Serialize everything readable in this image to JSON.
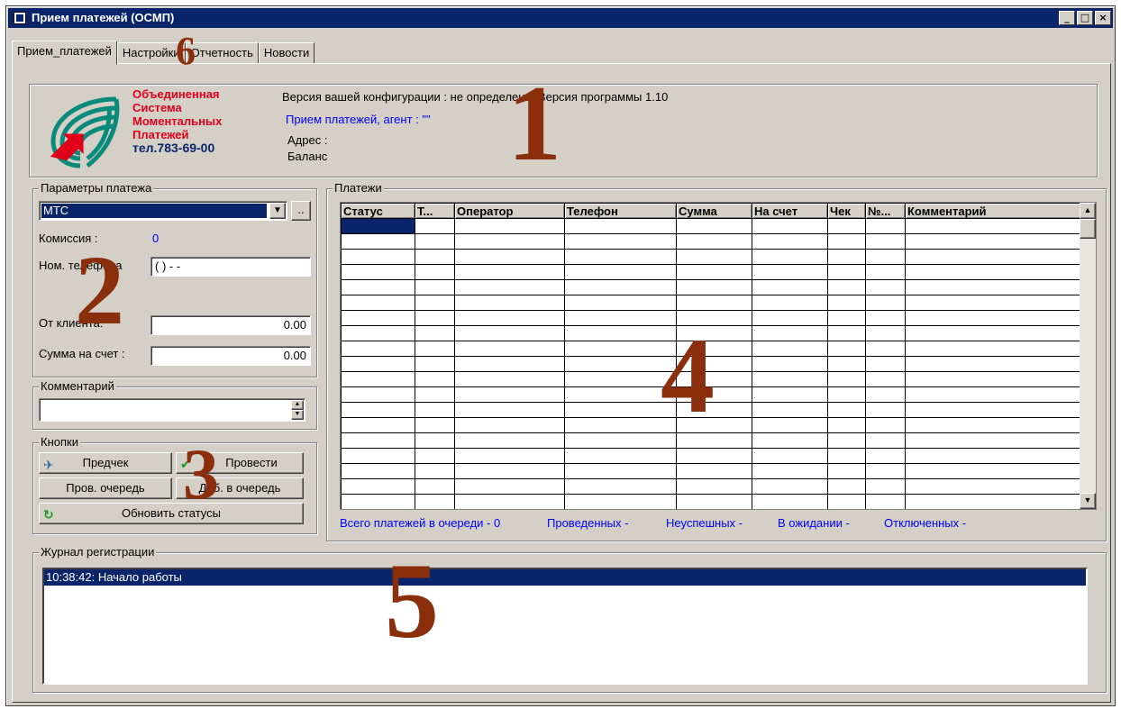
{
  "window": {
    "title": "Прием платежей (ОСМП)",
    "buttons": {
      "minimize": "_",
      "maximize": "□",
      "close": "×"
    }
  },
  "tabs": [
    {
      "label": "Прием_платежей",
      "active": true
    },
    {
      "label": "Настройки"
    },
    {
      "label": "Отчетность"
    },
    {
      "label": "Новости"
    }
  ],
  "logo": {
    "line1": "Объединенная",
    "line2": "Система",
    "line3": "Моментальных",
    "line4": "Платежей",
    "phone": "тел.783-69-00"
  },
  "info": {
    "version": "Версия вашей конфигурации :  не определена. Версия программы 1.10",
    "agent": "Прием платежей, агент : \"\"",
    "address": "Адрес :",
    "balance": "Баланс"
  },
  "params": {
    "legend": "Параметры платежа",
    "operator": "МТС",
    "browse": "..",
    "commission_label": "Комиссия :",
    "commission_value": "0",
    "phone_label": "Ном. телефона",
    "phone_value": "(  )  -  -",
    "from_client_label": "От клиента:",
    "from_client_value": "0.00",
    "to_account_label": "Сумма на счет :",
    "to_account_value": "0.00"
  },
  "comment": {
    "legend": "Комментарий",
    "value": ""
  },
  "buttons": {
    "legend": "Кнопки",
    "precheck": "Предчек",
    "submit": "Провести",
    "check_queue": "Пров. очередь",
    "add_queue": "Доб. в очередь",
    "refresh": "Обновить статусы"
  },
  "payments": {
    "legend": "Платежи",
    "columns": [
      "Статус",
      "Т...",
      "Оператор",
      "Телефон",
      "Сумма",
      "На счет",
      "Чек",
      "№...",
      "Комментарий"
    ],
    "row_count": 19,
    "summary": {
      "total": "Всего платежей в очереди - 0",
      "done": "Проведенных -",
      "failed": "Неуспешных -",
      "pending": "В ожидании -",
      "disabled": "Отключенных -"
    }
  },
  "log": {
    "legend": "Журнал регистрации",
    "entries": [
      "10:38:42: Начало работы"
    ]
  },
  "callouts": [
    "1",
    "2",
    "3",
    "4",
    "5",
    "6"
  ],
  "colors": {
    "titlebar": "#0a246a",
    "selection": "#0a246a",
    "logo_red": "#e0001a",
    "logo_teal": "#0a8a7a",
    "callout": "#8b2e0c",
    "link_blue": "#0000ff"
  }
}
